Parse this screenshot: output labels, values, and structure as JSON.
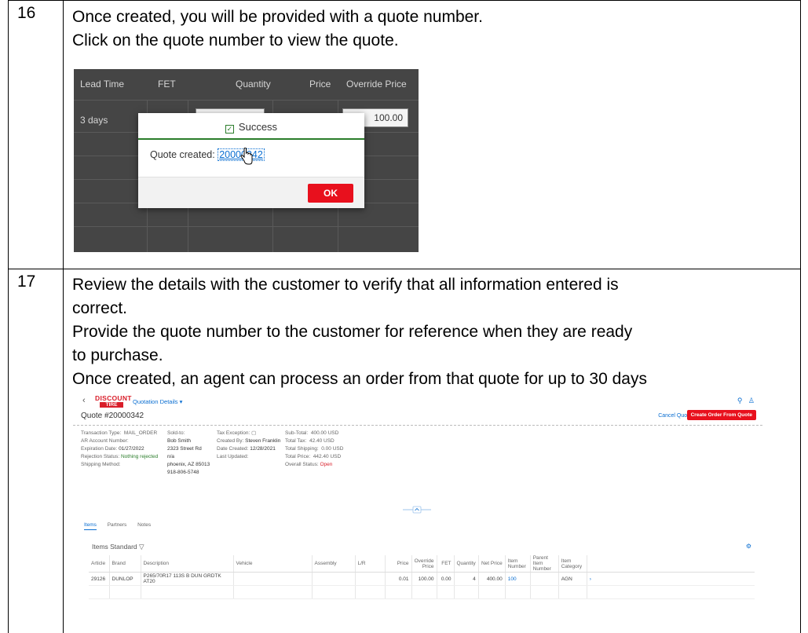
{
  "steps": [
    {
      "number": "16",
      "lines": [
        "Once created, you will be provided with a quote number.",
        "Click on the quote number to view the quote."
      ],
      "screenshot": {
        "columns": [
          "Lead Time",
          "FET",
          "Quantity",
          "Price",
          "Override Price"
        ],
        "cell_lead_time": "3 days",
        "override_value": "100.00",
        "modal": {
          "title": "Success",
          "label": "Quote created:",
          "quote_number": "20000342",
          "ok_label": "OK"
        }
      }
    },
    {
      "number": "17",
      "lines": [
        "Review the details with the customer to verify that all information entered is",
        "correct.",
        "Provide the quote number to the customer for reference when they are ready",
        "to purchase.",
        "Once created, an agent can process an order from that quote for up to 30 days"
      ],
      "screenshot": {
        "logo_top": "DISCOUNT",
        "logo_bottom": "TIRE",
        "app_title": "Quotation Details ▾",
        "quote_title": "Quote #20000342",
        "cancel_label": "Cancel Quote",
        "create_label": "Create Order From Quote",
        "col1": {
          "transaction_type": "Transaction Type:  MAIL_ORDER",
          "ar_account": "AR Account Number:",
          "expiration_label": "Expiration Date:",
          "expiration_value": "01/27/2022",
          "rejection_label": "Rejection Status:",
          "rejection_value": "Nothing rejected",
          "shipping": "Shipping Method:"
        },
        "col2": {
          "sold_to": "Sold-to:",
          "name": "Bob Smith",
          "street": "2323 Street Rd",
          "n_a": "n/a",
          "city": "phoenix, AZ 85013",
          "phone": "918-806-5748"
        },
        "col3": {
          "tax_exception": "Tax Exception:",
          "created_by_label": "Created By:",
          "created_by_value": "Steven Franklin",
          "date_created_label": "Date Created:",
          "date_created_value": "12/28/2021",
          "last_updated": "Last Updated:"
        },
        "col4": {
          "subtotal": "Sub-Total:  400.00 USD",
          "tax": "Total Tax:  42.40 USD",
          "shipping": "Total Shipping:  0.00 USD",
          "price": "Total Price:  442.40 USD",
          "status_label": "Overall Status:",
          "status_value": "Open"
        },
        "tabs": [
          "Items",
          "Partners",
          "Notes"
        ],
        "items_header": "Items  Standard ▽",
        "table_headers": [
          "Article",
          "Brand",
          "Description",
          "Vehicle",
          "Assembly",
          "L/R",
          "Price",
          "Override Price",
          "FET",
          "Quantity",
          "Net Price",
          "Item Number",
          "Parent Item Number",
          "Item Category",
          ""
        ],
        "table_row": [
          "29126",
          "DUNLOP",
          "P265/70R17 113S B DUN GRDTK AT20",
          "",
          "",
          "",
          "0.01",
          "100.00",
          "0.00",
          "4",
          "400.00",
          "100",
          "",
          "AGN",
          "›"
        ]
      }
    }
  ],
  "colors": {
    "accent_red": "#e8101d",
    "link_blue": "#0a6ed1",
    "success_green": "#2b7d2b",
    "dark_bg": "#454545"
  }
}
